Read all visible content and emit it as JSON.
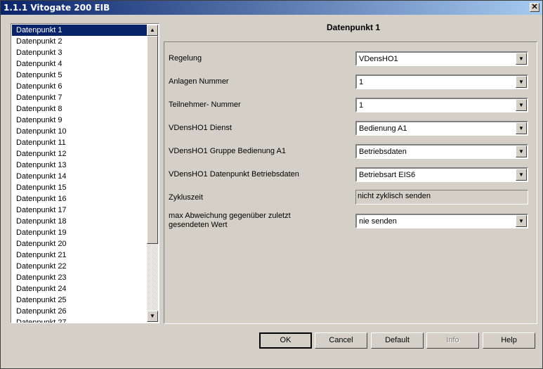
{
  "window": {
    "title": "1.1.1 Vitogate 200 EIB",
    "close_glyph": "✕"
  },
  "list": {
    "selected_index": 0,
    "items": [
      "Datenpunkt 1",
      "Datenpunkt 2",
      "Datenpunkt 3",
      "Datenpunkt 4",
      "Datenpunkt 5",
      "Datenpunkt 6",
      "Datenpunkt 7",
      "Datenpunkt 8",
      "Datenpunkt 9",
      "Datenpunkt 10",
      "Datenpunkt 11",
      "Datenpunkt 12",
      "Datenpunkt 13",
      "Datenpunkt 14",
      "Datenpunkt 15",
      "Datenpunkt 16",
      "Datenpunkt 17",
      "Datenpunkt 18",
      "Datenpunkt 19",
      "Datenpunkt 20",
      "Datenpunkt 21",
      "Datenpunkt 22",
      "Datenpunkt 23",
      "Datenpunkt 24",
      "Datenpunkt 25",
      "Datenpunkt 26",
      "Datenpunkt 27"
    ],
    "scroll_up_glyph": "▲",
    "scroll_down_glyph": "▼"
  },
  "panel": {
    "title": "Datenpunkt 1",
    "rows": [
      {
        "label": "Regelung",
        "value": "VDensHO1"
      },
      {
        "label": "Anlagen Nummer",
        "value": "1"
      },
      {
        "label": "Teilnehmer- Nummer",
        "value": "1"
      },
      {
        "label": "VDensHO1 Dienst",
        "value": "Bedienung A1"
      },
      {
        "label": "VDensHO1 Gruppe Bedienung A1",
        "value": "Betriebsdaten"
      },
      {
        "label": "VDensHO1 Datenpunkt Betriebsdaten",
        "value": "Betriebsart EIS6"
      }
    ],
    "zykluszeit": {
      "label": "Zykluszeit",
      "value": "nicht zyklisch senden"
    },
    "abweichung": {
      "label_line1": "max Abweichung gegenüber zuletzt",
      "label_line2": "gesendeten Wert",
      "value": "nie senden"
    },
    "arrow_glyph": "▼"
  },
  "buttons": {
    "ok": "OK",
    "cancel": "Cancel",
    "default": "Default",
    "info": "Info",
    "help": "Help"
  }
}
